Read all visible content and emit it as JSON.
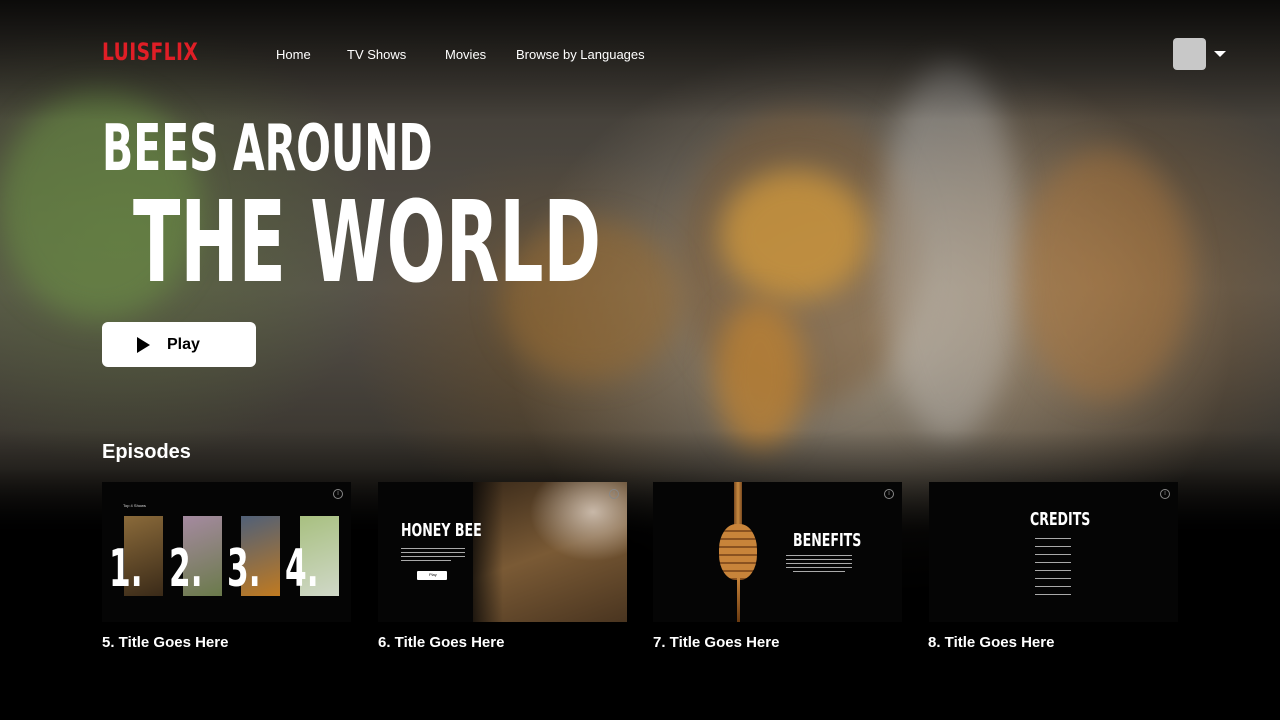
{
  "brand": {
    "logo": "LUISFLIX",
    "accent_color": "#e01e26"
  },
  "nav": {
    "items": [
      {
        "label": "Home"
      },
      {
        "label": "TV Shows"
      },
      {
        "label": "Movies"
      },
      {
        "label": "Browse by Languages"
      }
    ],
    "avatar_icon": "user-avatar",
    "menu_icon": "caret-down-icon"
  },
  "hero": {
    "title_line1": "BEES AROUND",
    "title_line2": "THE WORLD",
    "play_label": "Play",
    "play_icon": "play-icon"
  },
  "episodes": {
    "heading": "Episodes",
    "cards": [
      {
        "title": "5. Title Goes Here",
        "thumb_caption": "Top 4 Shows",
        "numbers": [
          "1.",
          "2.",
          "3.",
          "4."
        ]
      },
      {
        "title": "6. Title Goes Here",
        "thumb_title": "HONEY BEE",
        "thumb_button": "Play"
      },
      {
        "title": "7. Title Goes Here",
        "thumb_title": "BENEFITS"
      },
      {
        "title": "8.  Title Goes Here",
        "thumb_title": "CREDITS"
      }
    ]
  }
}
